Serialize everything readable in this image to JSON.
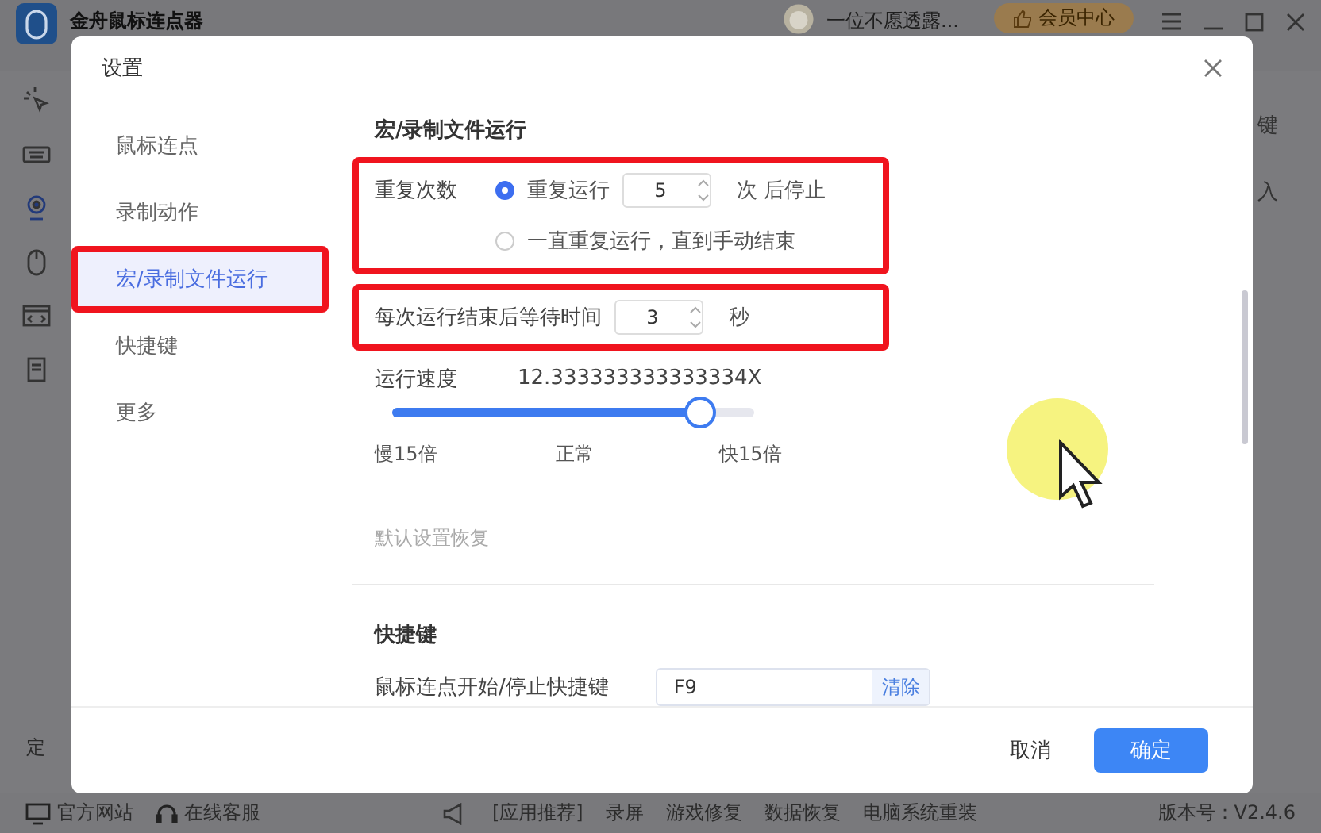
{
  "app": {
    "title": "金舟鼠标连点器",
    "user_name": "一位不愿透露...",
    "vip_button": "会员中心",
    "sidebar_partial_label": "定",
    "right_partial_labels": [
      "键",
      "入"
    ]
  },
  "bottom_bar": {
    "links": [
      {
        "label": "官方网站",
        "kind": "monitor"
      },
      {
        "label": "在线客服",
        "kind": "headset"
      }
    ],
    "promo_label": "[应用推荐]",
    "promo_links": [
      "录屏",
      "游戏修复",
      "数据恢复",
      "电脑系统重装"
    ],
    "version": "版本号：V2.4.6"
  },
  "dialog": {
    "title": "设置",
    "nav": [
      {
        "label": "鼠标连点",
        "selected": false,
        "highlighted": false
      },
      {
        "label": "录制动作",
        "selected": false,
        "highlighted": false
      },
      {
        "label": "宏/录制文件运行",
        "selected": true,
        "highlighted": true
      },
      {
        "label": "快捷键",
        "selected": false,
        "highlighted": false
      },
      {
        "label": "更多",
        "selected": false,
        "highlighted": false
      }
    ],
    "section_title": "宏/录制文件运行",
    "repeat": {
      "label": "重复次数",
      "highlighted": true,
      "options": [
        {
          "label": "重复运行",
          "selected": true,
          "count": "5",
          "suffix": "次 后停止"
        },
        {
          "label": "一直重复运行，直到手动结束",
          "selected": false
        }
      ]
    },
    "wait": {
      "label": "每次运行结束后等待时间",
      "value": "3",
      "unit": "秒",
      "highlighted": true
    },
    "speed": {
      "label": "运行速度",
      "reading": "12.333333333333334X",
      "level": 0.85,
      "scale": [
        "慢15倍",
        "正常",
        "快15倍"
      ]
    },
    "reset_link": "默认设置恢复",
    "shortcuts": {
      "title": "快捷键",
      "rows": [
        {
          "label": "鼠标连点开始/停止快捷键",
          "value": "F9",
          "clear": "清除"
        }
      ]
    },
    "buttons": {
      "cancel": "取消",
      "ok": "确定"
    }
  }
}
